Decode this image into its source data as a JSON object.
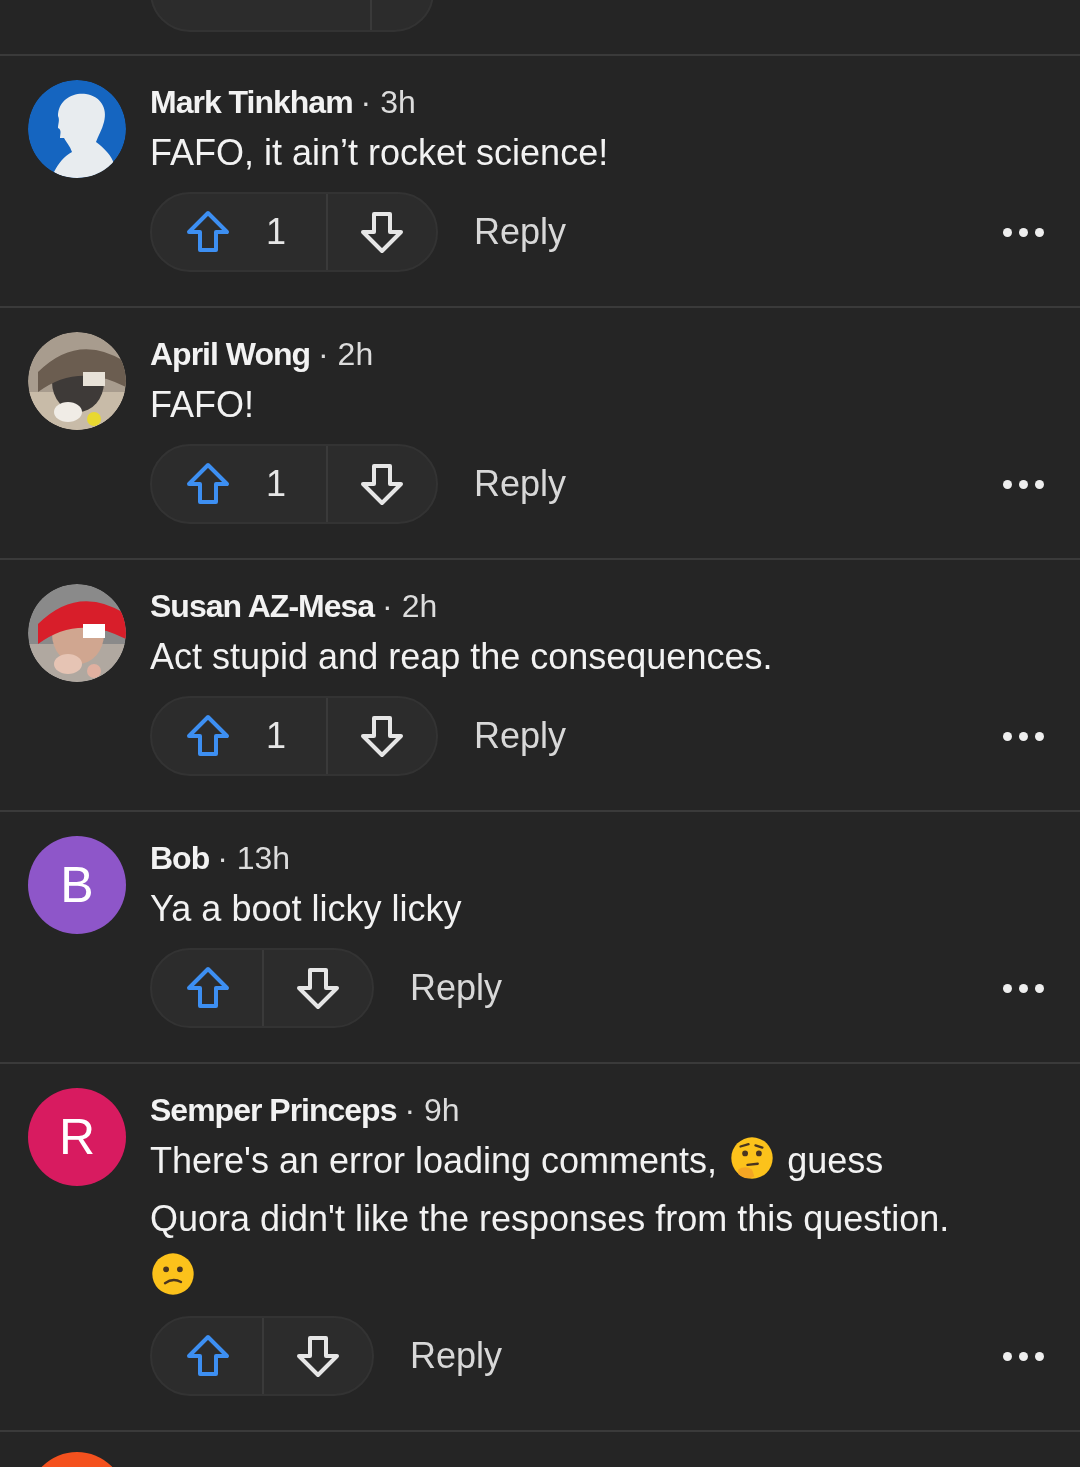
{
  "comments": [
    {
      "author": "Mark Tinkham",
      "time": "· 3h",
      "avatar": {
        "kind": "silhouette",
        "color": "#1565c0"
      },
      "body": [
        {
          "kind": "text",
          "text": "FAFO, it ain’t rocket science!"
        }
      ],
      "votes": "1",
      "reply": "Reply"
    },
    {
      "author": "April Wong",
      "time": "· 2h",
      "body": [
        {
          "kind": "text",
          "text": "FAFO!"
        }
      ],
      "votes": "1",
      "reply": "Reply"
    },
    {
      "author": "Susan AZ-Mesa",
      "time": "· 2h",
      "body": [
        {
          "kind": "text",
          "text": "Act stupid and reap the consequences."
        }
      ],
      "votes": "1",
      "reply": "Reply"
    },
    {
      "author": "Bob",
      "time": "· 13h",
      "avatar": {
        "kind": "letter",
        "letter": "B",
        "color": "#8e56c9"
      },
      "body": [
        {
          "kind": "text",
          "text": "Ya a boot licky licky"
        }
      ],
      "reply": "Reply"
    },
    {
      "author": "Semper Princeps",
      "time": "· 9h",
      "avatar": {
        "kind": "letter",
        "letter": "R",
        "color": "#d81b60"
      },
      "body": [
        {
          "kind": "text",
          "text": "There's an error loading comments,"
        },
        {
          "kind": "thinking-emoji"
        },
        {
          "kind": "text",
          "text": "guess Quora didn't like the responses from this question."
        },
        {
          "kind": "confused-emoji"
        }
      ],
      "reply": "Reply"
    }
  ],
  "next_avatar": {
    "color": "#f4511e"
  }
}
